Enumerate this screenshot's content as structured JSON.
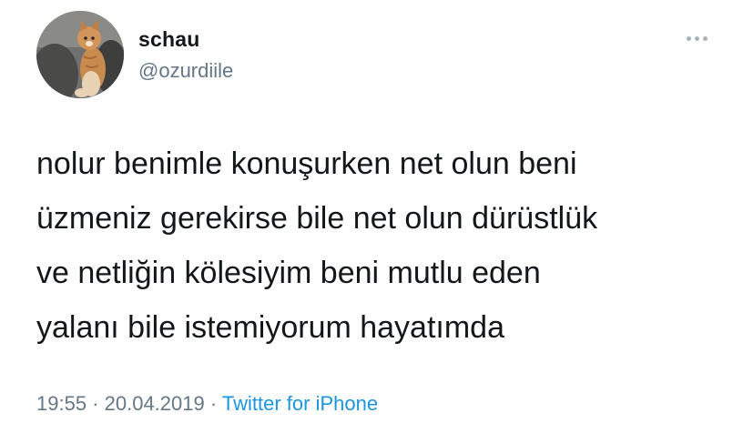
{
  "tweet": {
    "author": {
      "display_name": "schau",
      "handle": "@ozurdiile"
    },
    "text_lines": [
      "nolur benimle konuşurken net olun beni",
      "üzmeniz gerekirse bile net olun dürüstlük",
      "ve netliğin kölesiyim beni mutlu eden",
      "yalanı bile istemiyorum hayatımda"
    ],
    "meta": {
      "time": "19:55",
      "separator": " · ",
      "date": "20.04.2019",
      "source": "Twitter for iPhone"
    }
  },
  "colors": {
    "text": "#14171a",
    "secondary": "#657786",
    "link": "#1b95e0",
    "more_dots": "#a7b2bb"
  },
  "icons": {
    "more": "more-horizontal-icon"
  }
}
